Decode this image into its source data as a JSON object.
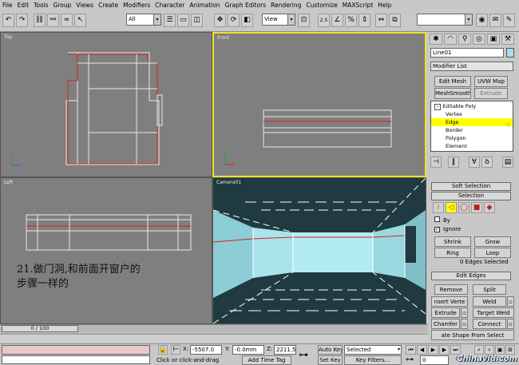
{
  "menu": [
    "File",
    "Edit",
    "Tools",
    "Group",
    "Views",
    "Create",
    "Modifiers",
    "Character",
    "Animation",
    "Graph Editors",
    "Rendering",
    "Customize",
    "MAXScript",
    "Help"
  ],
  "toolbar": {
    "filter_value": "All",
    "refcoord_value": "View",
    "snap_value": "2.5",
    "pct_value": "%"
  },
  "viewports": {
    "top": "Top",
    "front": "Front",
    "left": "Left",
    "camera": "Camera01"
  },
  "note": "21.做门洞,和前面开窗户的\n步骤一样的",
  "panel": {
    "object_name": "Line01",
    "modifier_list": "Modifier List",
    "btn_edit_mesh": "Edit Mesh",
    "btn_uvw_map": "UVW Map",
    "btn_meshsmooth": "MeshSmooth",
    "btn_extrude": "Extrude",
    "stack": [
      "Editable Poly",
      "Vertex",
      "Edge",
      "Border",
      "Polygon",
      "Element"
    ],
    "soft_selection": "Soft Selection",
    "selection": "Selection",
    "by": "By",
    "ignore": "Ignore",
    "shrink": "Shrink",
    "grow": "Grow",
    "ring": "Ring",
    "loop": "Loop",
    "status": "0 Edges Selected",
    "edit_edges": "Edit Edges",
    "remove": "Remove",
    "split": "Split",
    "insert_vertex": "nsert Verte",
    "weld": "Weld",
    "extrude2": "Extrude",
    "target_weld": "Target Weld",
    "chamfer": "Chamfer",
    "connect": "Connect",
    "create_shape": "ate Shape From Select"
  },
  "timeline": {
    "frame": "0 / 100"
  },
  "status": {
    "x_label": "X:",
    "x_value": "-5507.0",
    "y_label": "Y:",
    "y_value": "-0.0mm",
    "z_label": "Z:",
    "z_value": "2211.5",
    "prompt": "Click or click-and-drag",
    "add_time_tag": "Add Time Tag",
    "auto_key": "Auto Key",
    "selected": "Selected",
    "set_key": "Set Key",
    "key_filters": "Key Filters...",
    "frame_field": "0"
  },
  "watermark": "Chinavid.com",
  "colors": {
    "viewport_bg": "#7f7f7f",
    "active_border": "#f2e12a",
    "edge_highlight": "#ffff00",
    "camera_bg": "#1f3a40",
    "wall": "#a8e4ea"
  }
}
